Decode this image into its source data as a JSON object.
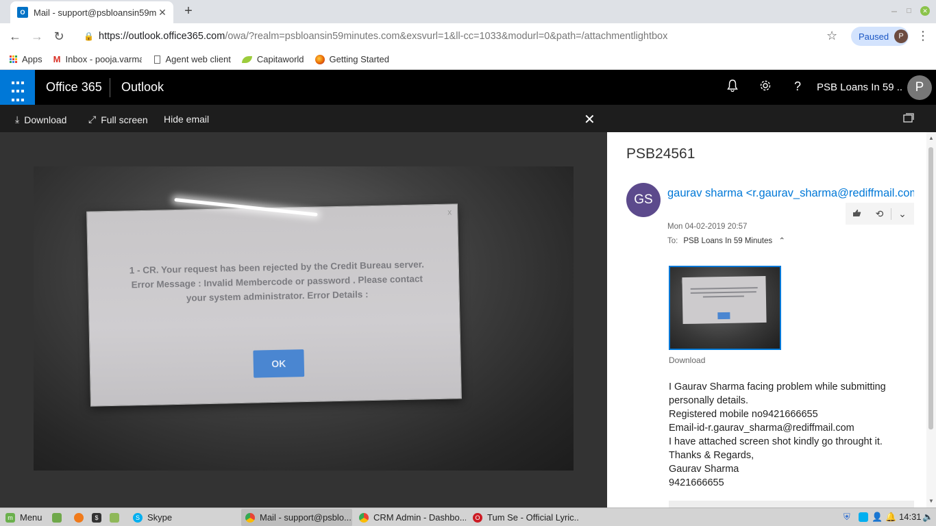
{
  "browser": {
    "tab_title": "Mail - support@psbloansin59m",
    "tab_favicon": "O",
    "new_tab": "+",
    "url_host": "https://outlook.office365.com",
    "url_rest": "/owa/?realm=psbloansin59minutes.com&exsvurl=1&ll-cc=1033&modurl=0&path=/attachmentlightbox",
    "profile_status": "Paused",
    "profile_initial": "P",
    "bookmarks": [
      {
        "label": "Apps",
        "icon": "apps-grid-icon"
      },
      {
        "label": "Inbox - pooja.varma",
        "icon": "gmail-icon"
      },
      {
        "label": "Agent web client",
        "icon": "page-icon"
      },
      {
        "label": "Capitaworld",
        "icon": "leaf-icon"
      },
      {
        "label": "Getting Started",
        "icon": "firefox-icon"
      }
    ]
  },
  "o365": {
    "suite": "Office 365",
    "app": "Outlook",
    "account_name": "PSB Loans In 59 ...",
    "account_initial": "P"
  },
  "lightbox": {
    "download": "Download",
    "full_screen": "Full screen",
    "hide_email": "Hide email"
  },
  "attachment_image": {
    "line1": "1 - CR. Your request has been rejected by the Credit Bureau server.",
    "line2": "Error Message : Invalid Membercode or password . Please contact",
    "line3": "your system administrator. Error Details :",
    "ok": "OK",
    "close": "x"
  },
  "email": {
    "subject": "PSB24561",
    "sender_initials": "GS",
    "sender": "gaurav sharma <r.gaurav_sharma@rediffmail.com>",
    "date": "Mon 04-02-2019 20:57",
    "to_label": "To:",
    "to": "PSB Loans In 59 Minutes",
    "attachment_download": "Download",
    "body": {
      "line1": "I Gaurav Sharma facing problem while submitting personally details.",
      "line2": "Registered mobile no9421666655",
      "line3": "Email-id-r.gaurav_sharma@rediffmail.com",
      "line4": "I have attached screen shot kindly go throught it.",
      "line5": "Thanks & Regards,",
      "line6": "Gaurav Sharma",
      "line7": "9421666655"
    }
  },
  "taskbar": {
    "menu": "Menu",
    "skype": "Skype",
    "mail": "Mail - support@psblo...",
    "crm": "CRM Admin - Dashbo...",
    "song": "Tum Se - Official Lyric...",
    "time": "14:31"
  },
  "colors": {
    "office_blue": "#0078d7",
    "header_black": "#000000",
    "avatar_purple": "#5c4a8c"
  }
}
